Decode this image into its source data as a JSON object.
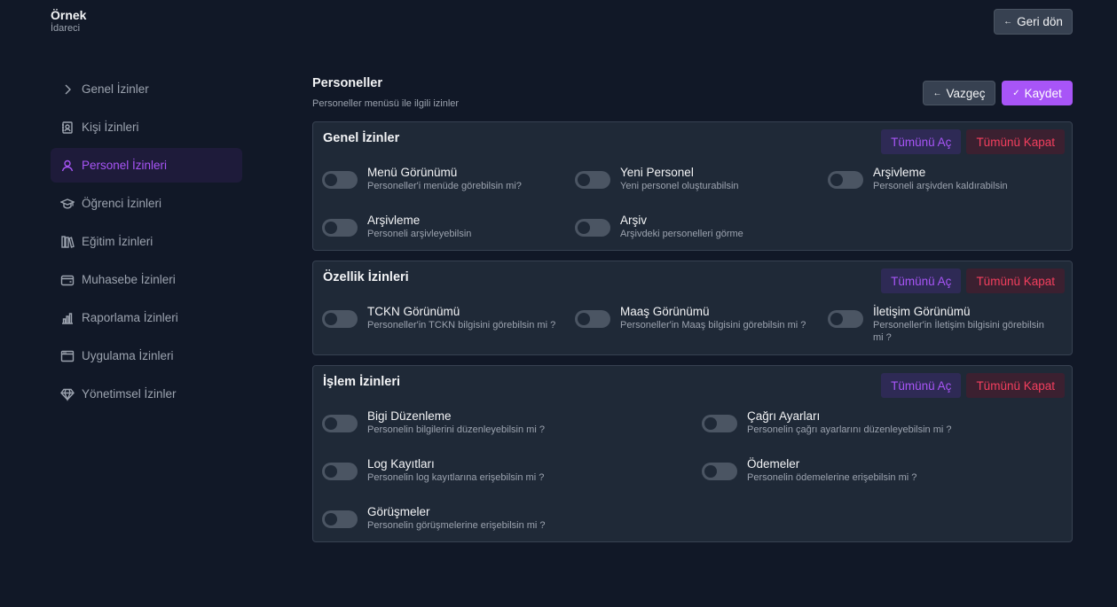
{
  "brand": {
    "name": "Örnek",
    "role": "İdareci"
  },
  "back_button": {
    "label": "Geri dön",
    "icon": "arrow-left-icon"
  },
  "sidebar": {
    "items": [
      {
        "label": "Genel İzinler",
        "icon": "chevron-right-icon"
      },
      {
        "label": "Kişi İzinleri",
        "icon": "address-book-icon"
      },
      {
        "label": "Personel İzinleri",
        "icon": "user-icon",
        "active": true
      },
      {
        "label": "Öğrenci İzinleri",
        "icon": "graduation-cap-icon"
      },
      {
        "label": "Eğitim İzinleri",
        "icon": "books-icon"
      },
      {
        "label": "Muhasebe İzinleri",
        "icon": "wallet-icon"
      },
      {
        "label": "Raporlama İzinleri",
        "icon": "bar-chart-icon"
      },
      {
        "label": "Uygulama İzinleri",
        "icon": "app-window-icon"
      },
      {
        "label": "Yönetimsel İzinler",
        "icon": "diamond-icon"
      }
    ]
  },
  "main": {
    "title": "Personeller",
    "subtitle": "Personeller menüsü ile ilgili izinler",
    "cancel_label": "Vazgeç",
    "save_label": "Kaydet"
  },
  "common": {
    "open_all": "Tümünü Aç",
    "close_all": "Tümünü Kapat"
  },
  "sections": [
    {
      "title": "Genel İzinler",
      "perms": [
        {
          "title": "Menü Görünümü",
          "desc": "Personeller'i menüde görebilsin mi?"
        },
        {
          "title": "Yeni Personel",
          "desc": "Yeni personel oluşturabilsin"
        },
        {
          "title": "Arşivleme",
          "desc": "Personeli arşivden kaldırabilsin"
        },
        {
          "title": "Arşivleme",
          "desc": "Personeli arşivleyebilsin"
        },
        {
          "title": "Arşiv",
          "desc": "Arşivdeki personelleri görme"
        }
      ]
    },
    {
      "title": "Özellik İzinleri",
      "perms": [
        {
          "title": "TCKN Görünümü",
          "desc": "Personeller'in TCKN bilgisini görebilsin mi ?"
        },
        {
          "title": "Maaş Görünümü",
          "desc": "Personeller'in Maaş bilgisini görebilsin mi ?"
        },
        {
          "title": "İletişim Görünümü",
          "desc": "Personeller'in İletişim bilgisini görebilsin mi ?"
        }
      ]
    },
    {
      "title": "İşlem İzinleri",
      "perms": [
        {
          "title": "Bigi Düzenleme",
          "desc": "Personelin bilgilerini düzenleyebilsin mi ?"
        },
        {
          "title": "Çağrı Ayarları",
          "desc": "Personelin çağrı ayarlarını düzenleyebilsin mi ?"
        },
        {
          "title": "Log Kayıtları",
          "desc": "Personelin log kayıtlarına erişebilsin mi ?"
        },
        {
          "title": "Ödemeler",
          "desc": "Personelin ödemelerine erişebilsin mi ?"
        },
        {
          "title": "Görüşmeler",
          "desc": "Personelin görüşmelerine erişebilsin mi ?"
        }
      ]
    }
  ]
}
